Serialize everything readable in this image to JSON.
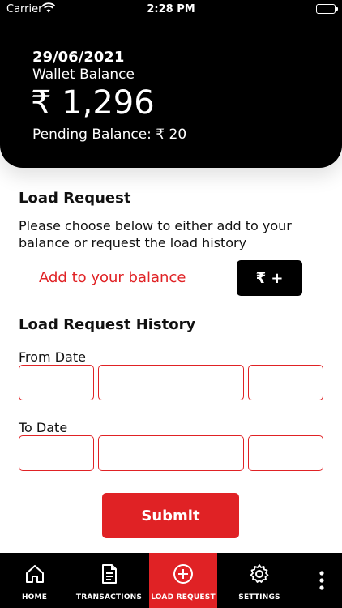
{
  "status_bar": {
    "carrier": "Carrier",
    "time": "2:28 PM"
  },
  "header": {
    "date": "29/06/2021",
    "wallet_label": "Wallet Balance",
    "balance": "₹ 1,296",
    "pending": "Pending Balance: ₹ 20"
  },
  "load_request": {
    "title": "Load Request",
    "description": "Please choose below to either add to your balance or request the load history",
    "add_label": "Add to your balance",
    "add_button": "₹ +"
  },
  "history": {
    "title": "Load Request History",
    "from_label": "From Date",
    "to_label": "To Date",
    "submit": "Submit"
  },
  "nav": {
    "items": [
      {
        "label": "HOME",
        "icon": "home-icon"
      },
      {
        "label": "TRANSACTIONS",
        "icon": "document-icon"
      },
      {
        "label": "LOAD REQUEST",
        "icon": "plus-circle-icon",
        "active": true
      },
      {
        "label": "SETTINGS",
        "icon": "gear-icon"
      }
    ],
    "more_icon": "more-vertical-icon"
  },
  "colors": {
    "accent": "#e02225",
    "dark": "#000000",
    "background": "#ffffff"
  }
}
